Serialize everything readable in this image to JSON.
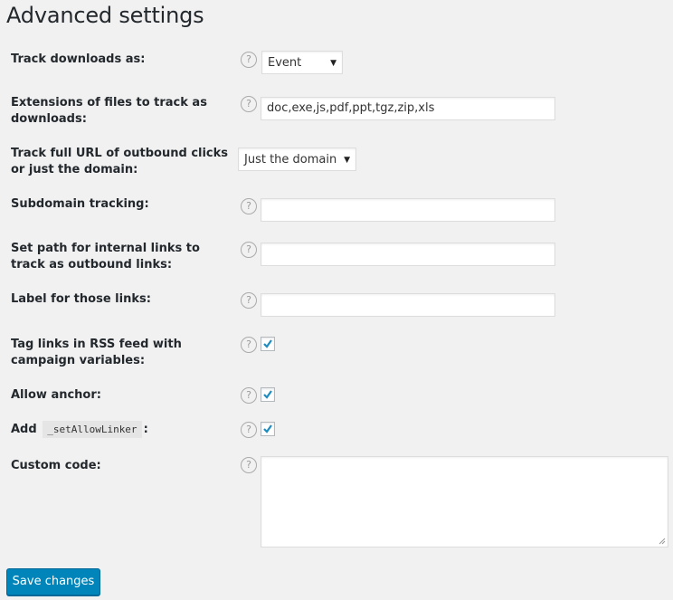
{
  "page_title": "Advanced settings",
  "fields": {
    "track_downloads": {
      "label": "Track downloads as:",
      "value": "Event"
    },
    "extensions": {
      "label": "Extensions of files to track as downloads:",
      "value": "doc,exe,js,pdf,ppt,tgz,zip,xls"
    },
    "outbound_url": {
      "label": "Track full URL of outbound clicks or just the domain:",
      "value": "Just the domain"
    },
    "subdomain": {
      "label": "Subdomain tracking:",
      "value": ""
    },
    "internal_path": {
      "label": "Set path for internal links to track as outbound links:",
      "value": ""
    },
    "link_label": {
      "label": "Label for those links:",
      "value": ""
    },
    "rss_tag": {
      "label": "Tag links in RSS feed with campaign variables:",
      "checked": true
    },
    "allow_anchor": {
      "label": "Allow anchor:",
      "checked": true
    },
    "allow_linker": {
      "label_prefix": "Add",
      "code": "_setAllowLinker",
      "label_suffix": ":",
      "checked": true
    },
    "custom_code": {
      "label": "Custom code:",
      "value": ""
    }
  },
  "help_icon_glyph": "?",
  "dropdown_arrow": "▼",
  "save_button": "Save changes"
}
